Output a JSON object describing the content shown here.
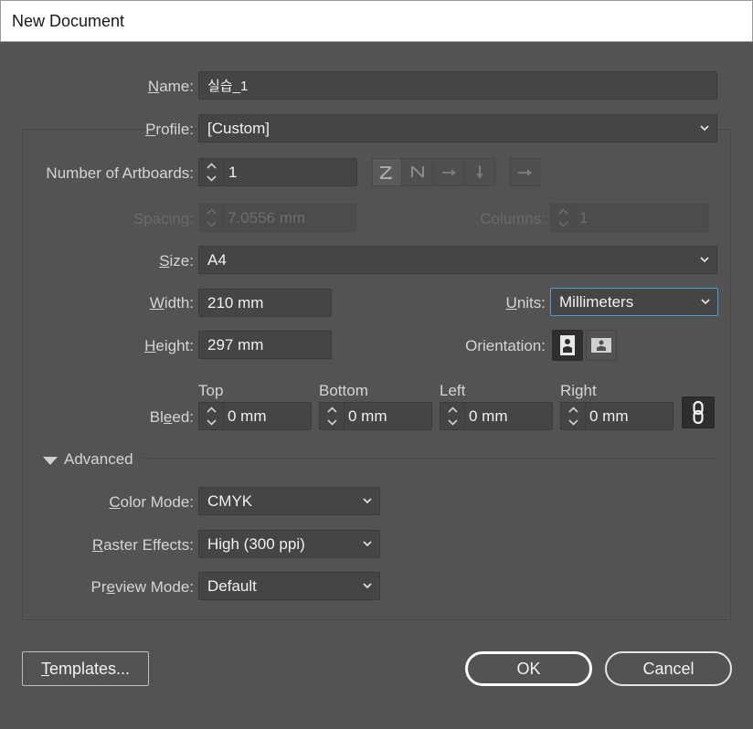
{
  "window": {
    "title": "New Document"
  },
  "name": {
    "label": "Name:",
    "value": "실습_1"
  },
  "profile": {
    "label": "Profile:",
    "value": "[Custom]"
  },
  "artboards": {
    "label": "Number of Artboards:",
    "value": "1"
  },
  "spacing": {
    "label": "Spacing:",
    "value": "7.0556 mm"
  },
  "columns": {
    "label": "Columns:",
    "value": "1"
  },
  "size": {
    "label": "Size:",
    "value": "A4"
  },
  "width": {
    "label": "Width:",
    "value": "210 mm"
  },
  "units": {
    "label": "Units:",
    "value": "Millimeters"
  },
  "height": {
    "label": "Height:",
    "value": "297 mm"
  },
  "orientation": {
    "label": "Orientation:",
    "selected": "portrait"
  },
  "bleed": {
    "label": "Bleed:",
    "top": {
      "label": "Top",
      "value": "0 mm"
    },
    "bottom": {
      "label": "Bottom",
      "value": "0 mm"
    },
    "left": {
      "label": "Left",
      "value": "0 mm"
    },
    "right": {
      "label": "Right",
      "value": "0 mm"
    }
  },
  "advanced": {
    "label": "Advanced",
    "expanded": true
  },
  "color_mode": {
    "label": "Color Mode:",
    "value": "CMYK"
  },
  "raster_effects": {
    "label": "Raster Effects:",
    "value": "High (300 ppi)"
  },
  "preview_mode": {
    "label": "Preview Mode:",
    "value": "Default"
  },
  "buttons": {
    "templates": "Templates...",
    "ok": "OK",
    "cancel": "Cancel"
  },
  "colors": {
    "background": "#535353",
    "field": "#454545",
    "focus": "#4b9bd6"
  }
}
